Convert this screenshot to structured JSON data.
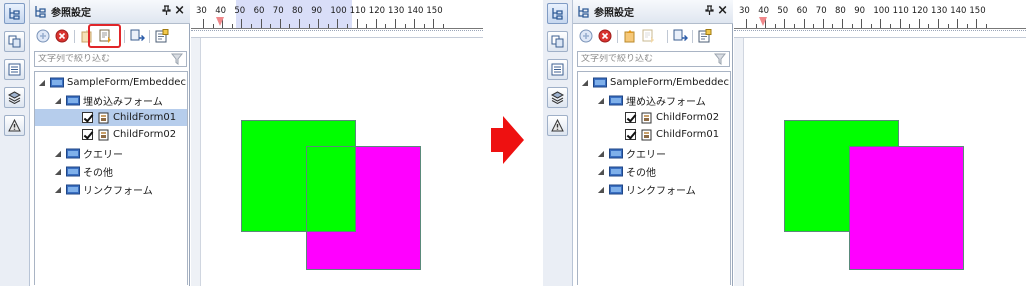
{
  "panel": {
    "title": "参照設定",
    "pin_glyph": "ꟷ",
    "close_glyph": "×",
    "search_placeholder": "文字列で絞り込む"
  },
  "iconbar_icons": [
    "tree-icon",
    "copy-icon",
    "list-icon",
    "layers-icon",
    "warning-icon"
  ],
  "toolbar_icons": [
    "add-circle-icon",
    "remove-circle-icon",
    "move-up-icon",
    "move-down-icon",
    "import-icon",
    "properties-icon"
  ],
  "ruler": {
    "labels": [
      "30",
      "40",
      "50",
      "60",
      "70",
      "80",
      "90",
      "100",
      "110",
      "120",
      "130",
      "140",
      "150"
    ],
    "highlight_range": [
      50,
      100
    ]
  },
  "before": {
    "tree": {
      "root": "SampleForm/Embeddec",
      "embedded": "埋め込みフォーム",
      "child1": "ChildForm01",
      "child2": "ChildForm02",
      "query": "クエリー",
      "other": "その他",
      "link": "リンクフォーム"
    }
  },
  "after": {
    "tree": {
      "root": "SampleForm/Embeddec",
      "embedded": "埋め込みフォーム",
      "child1": "ChildForm02",
      "child2": "ChildForm01",
      "query": "クエリー",
      "other": "その他",
      "link": "リンクフォーム"
    }
  },
  "shapes": {
    "green_color": "#00ff00",
    "magenta_color": "#ff00ff"
  },
  "colors": {
    "arrow": "#ee1111",
    "highlight_box": "#e0262a",
    "selection": "#b6cdec"
  }
}
